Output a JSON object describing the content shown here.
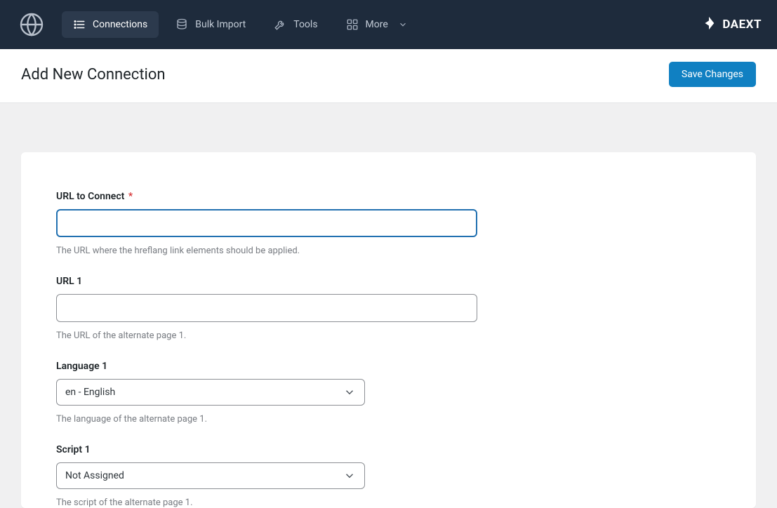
{
  "nav": {
    "items": [
      {
        "label": "Connections"
      },
      {
        "label": "Bulk Import"
      },
      {
        "label": "Tools"
      },
      {
        "label": "More"
      }
    ]
  },
  "brand": {
    "name": "DAEXT"
  },
  "header": {
    "title": "Add New Connection",
    "save_label": "Save Changes"
  },
  "fields": {
    "url_to_connect": {
      "label": "URL to Connect",
      "value": "",
      "help": "The URL where the hreflang link elements should be applied."
    },
    "url1": {
      "label": "URL 1",
      "value": "",
      "help": "The URL of the alternate page 1."
    },
    "language1": {
      "label": "Language 1",
      "selected": "en - English",
      "help": "The language of the alternate page 1."
    },
    "script1": {
      "label": "Script 1",
      "selected": "Not Assigned",
      "help": "The script of the alternate page 1."
    }
  }
}
